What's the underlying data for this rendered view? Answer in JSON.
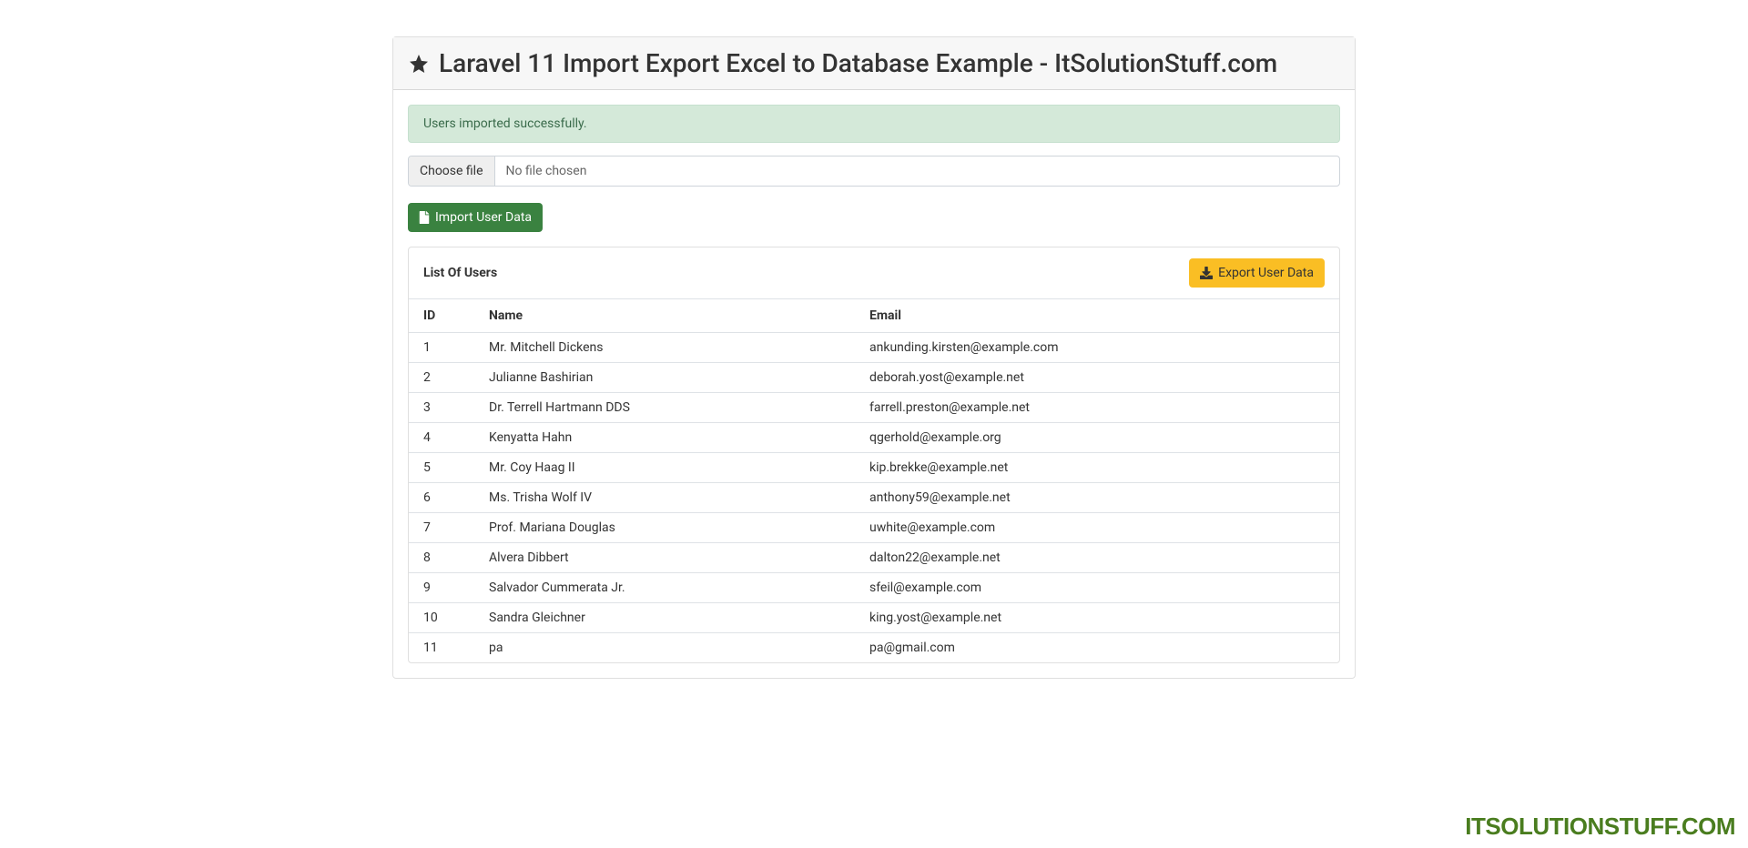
{
  "header": {
    "title": "Laravel 11 Import Export Excel to Database Example - ItSolutionStuff.com"
  },
  "alert": {
    "message": "Users imported successfully."
  },
  "fileInput": {
    "chooseLabel": "Choose file",
    "noFileText": "No file chosen"
  },
  "actions": {
    "importLabel": "Import User Data",
    "exportLabel": "Export User Data"
  },
  "table": {
    "title": "List Of Users",
    "columns": {
      "id": "ID",
      "name": "Name",
      "email": "Email"
    },
    "rows": [
      {
        "id": "1",
        "name": "Mr. Mitchell Dickens",
        "email": "ankunding.kirsten@example.com"
      },
      {
        "id": "2",
        "name": "Julianne Bashirian",
        "email": "deborah.yost@example.net"
      },
      {
        "id": "3",
        "name": "Dr. Terrell Hartmann DDS",
        "email": "farrell.preston@example.net"
      },
      {
        "id": "4",
        "name": "Kenyatta Hahn",
        "email": "qgerhold@example.org"
      },
      {
        "id": "5",
        "name": "Mr. Coy Haag II",
        "email": "kip.brekke@example.net"
      },
      {
        "id": "6",
        "name": "Ms. Trisha Wolf IV",
        "email": "anthony59@example.net"
      },
      {
        "id": "7",
        "name": "Prof. Mariana Douglas",
        "email": "uwhite@example.com"
      },
      {
        "id": "8",
        "name": "Alvera Dibbert",
        "email": "dalton22@example.net"
      },
      {
        "id": "9",
        "name": "Salvador Cummerata Jr.",
        "email": "sfeil@example.com"
      },
      {
        "id": "10",
        "name": "Sandra Gleichner",
        "email": "king.yost@example.net"
      },
      {
        "id": "11",
        "name": "pa",
        "email": "pa@gmail.com"
      }
    ]
  },
  "watermark": "ITSOLUTIONSTUFF.COM"
}
